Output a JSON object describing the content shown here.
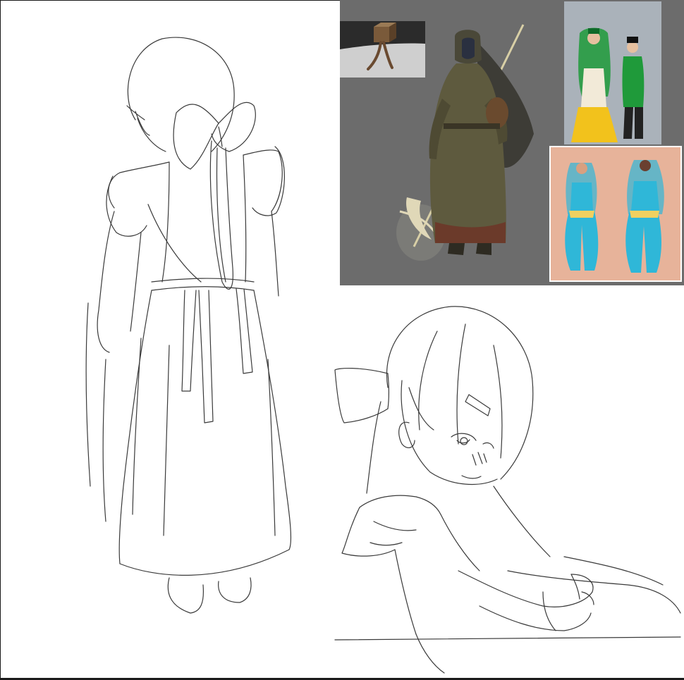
{
  "colors": {
    "canvas": "#ffffff",
    "sketch_line": "#3a3a3a",
    "sketch_light": "#9a9a9a",
    "reference_panel": "#6c6c6c",
    "robe": "#5e5a3e",
    "robe_hem": "#6b3a2a",
    "tatar_green": "#1f9a3a",
    "tatar_yellow": "#f2c21c",
    "dancer_blue": "#2fb7d8",
    "dancer_bg": "#e7b39a"
  },
  "icons": {
    "figure_back": "sketch-figure-back-icon",
    "figure_front": "sketch-figure-front-icon",
    "photo_box": "photo-box-doll-icon",
    "concept": "hooded-reaper-icon",
    "tatar": "folk-costume-photo-icon",
    "dancer": "belly-dancer-photo-icon"
  }
}
